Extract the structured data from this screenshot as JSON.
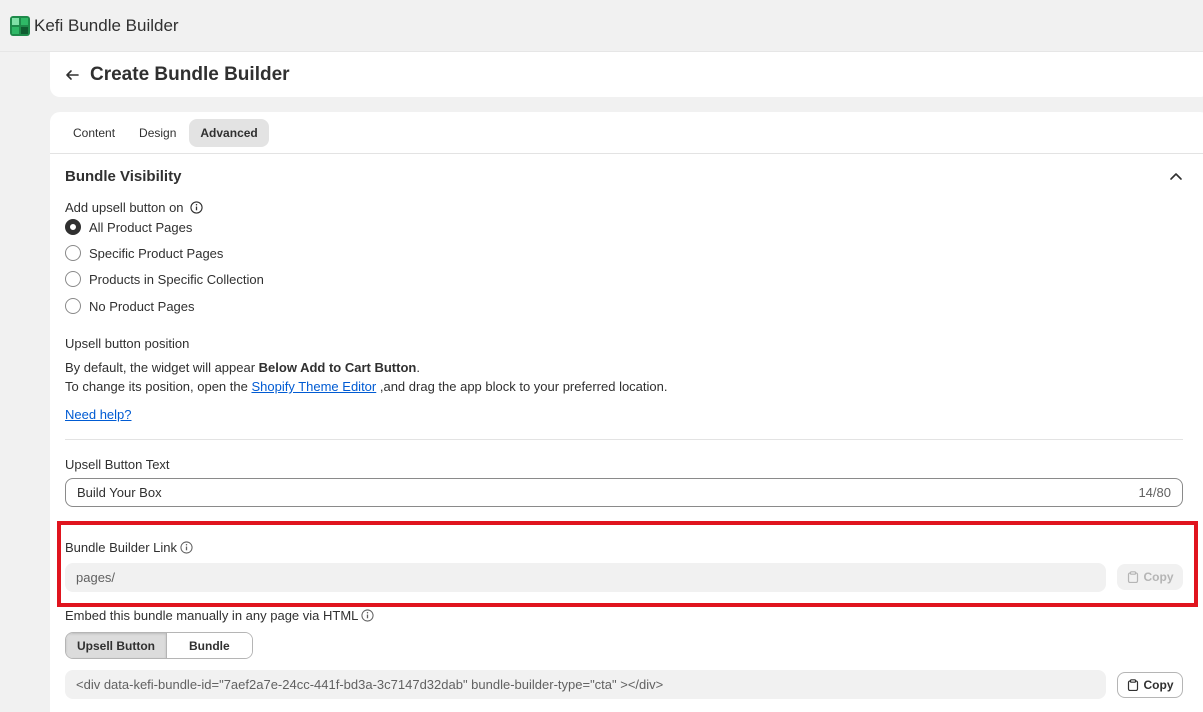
{
  "app": {
    "name": "Kefi Bundle Builder"
  },
  "header": {
    "title": "Create Bundle Builder"
  },
  "tabs": [
    {
      "label": "Content"
    },
    {
      "label": "Design"
    },
    {
      "label": "Advanced"
    }
  ],
  "visibility": {
    "title": "Bundle Visibility",
    "add_upsell_label": "Add upsell button on",
    "options": [
      {
        "label": "All Product Pages",
        "checked": true
      },
      {
        "label": "Specific Product Pages",
        "checked": false
      },
      {
        "label": "Products in Specific Collection",
        "checked": false
      },
      {
        "label": "No Product Pages",
        "checked": false
      }
    ]
  },
  "position": {
    "label": "Upsell button position",
    "line1_prefix": "By default, the widget will appear ",
    "line1_bold": "Below Add to Cart Button",
    "line1_suffix": ".",
    "line2_prefix": "To change its position, open the ",
    "line2_link": "Shopify Theme Editor",
    "line2_suffix": " ,and drag the app block to your preferred location.",
    "help_link": "Need help?"
  },
  "upsell_text": {
    "label": "Upsell Button Text",
    "value": "Build Your Box",
    "counter": "14/80"
  },
  "builder_link": {
    "label": "Bundle Builder Link",
    "value": "pages/",
    "copy_label": "Copy"
  },
  "embed": {
    "label": "Embed this bundle manually in any page via HTML",
    "segments": [
      {
        "label": "Upsell Button",
        "active": true
      },
      {
        "label": "Bundle",
        "active": false
      }
    ],
    "code": "<div data-kefi-bundle-id=\"7aef2a7e-24cc-441f-bd3a-3c7147d32dab\" bundle-builder-type=\"cta\" ></div>",
    "copy_label": "Copy"
  },
  "colors": {
    "highlight": "#e0141e",
    "link": "#005bd3",
    "brand_green": "#1e8a4a"
  }
}
